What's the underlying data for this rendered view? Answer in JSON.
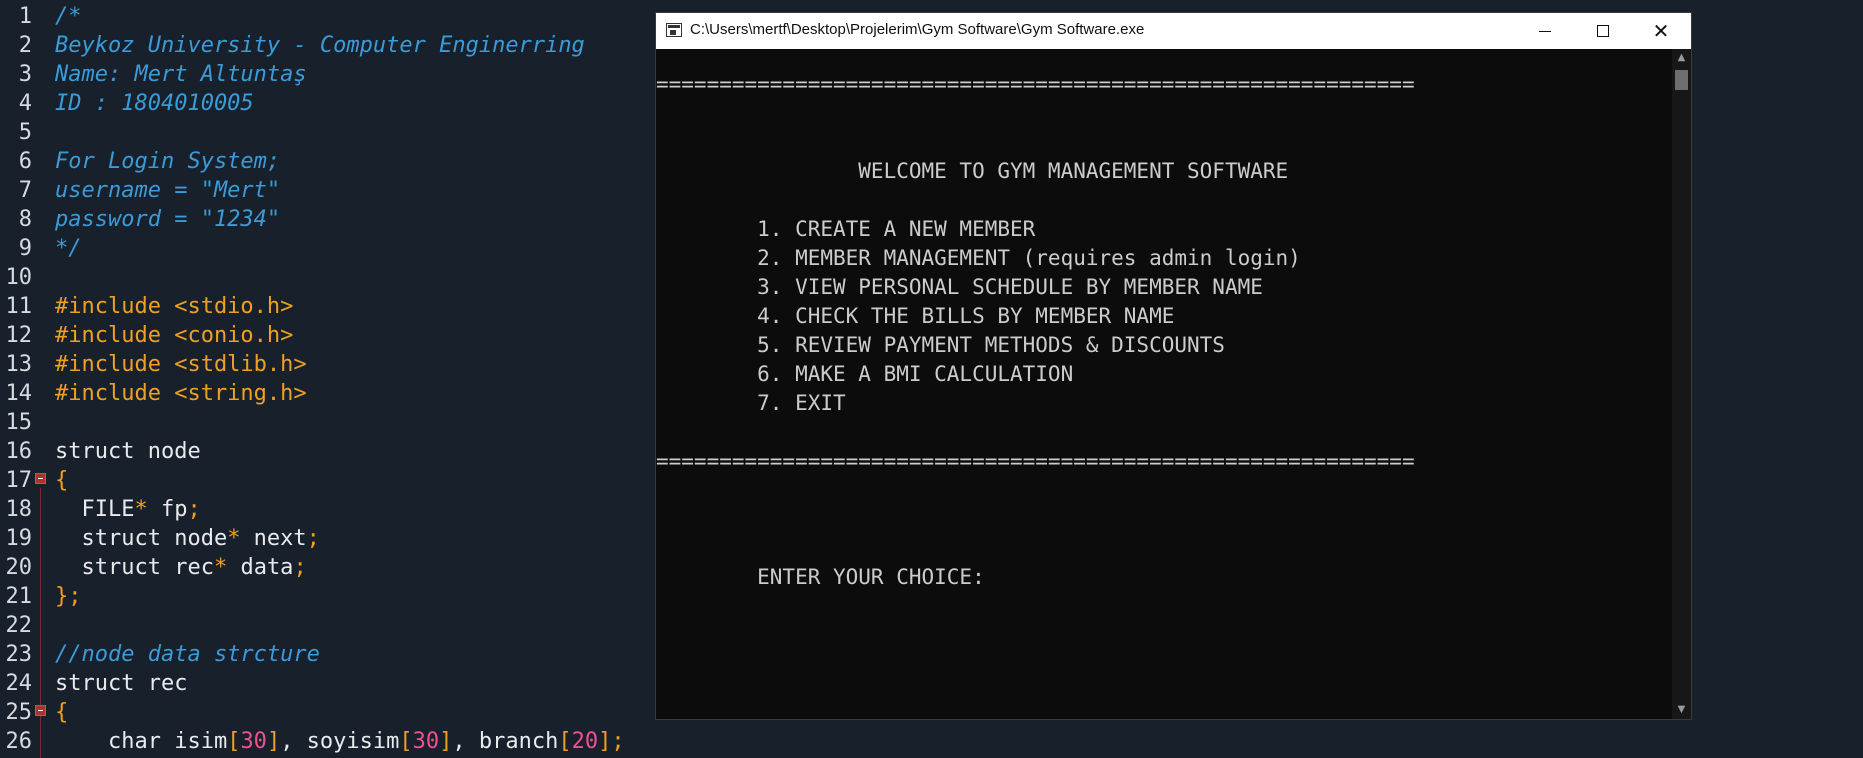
{
  "editor": {
    "line_numbers": [
      "1",
      "2",
      "3",
      "4",
      "5",
      "6",
      "7",
      "8",
      "9",
      "10",
      "11",
      "12",
      "13",
      "14",
      "15",
      "16",
      "17",
      "18",
      "19",
      "20",
      "21",
      "22",
      "23",
      "24",
      "25",
      "26"
    ],
    "lines": {
      "l1": "/*",
      "l2": "Beykoz University - Computer Enginerring",
      "l3": "Name: Mert Altuntaş",
      "l4": "ID : 1804010005",
      "l6": "For Login System;",
      "l7": "username = \"Mert\"",
      "l8": "password = \"1234\"",
      "l9": "*/",
      "l11": "#include <stdio.h>",
      "l12": "#include <conio.h>",
      "l13": "#include <stdlib.h>",
      "l14": "#include <string.h>",
      "l16_kw": "struct",
      "l16_rest": " node",
      "l17": "{",
      "l18_a": "  FILE",
      "l18_b": "*",
      "l18_c": " fp",
      "l18_d": ";",
      "l19_a": "  struct node",
      "l19_b": "*",
      "l19_c": " next",
      "l19_d": ";",
      "l20_a": "  struct rec",
      "l20_b": "*",
      "l20_c": " data",
      "l20_d": ";",
      "l21_a": "}",
      "l21_b": ";",
      "l23": "//node data strcture",
      "l24_kw": "struct",
      "l24_rest": " rec",
      "l25": "{",
      "l26_a": "    char isim",
      "l26_b": "[",
      "l26_c": "30",
      "l26_d": "]",
      "l26_e": ", soyisim",
      "l26_f": "[",
      "l26_g": "30",
      "l26_h": "]",
      "l26_i": ", branch",
      "l26_j": "[",
      "l26_k": "20",
      "l26_l": "]",
      "l26_m": ";"
    }
  },
  "console": {
    "title": "C:\\Users\\mertf\\Desktop\\Projelerim\\Gym Software\\Gym Software.exe",
    "separator": "============================================================",
    "welcome": "                WELCOME TO GYM MANAGEMENT SOFTWARE",
    "menu": [
      "        1. CREATE A NEW MEMBER",
      "        2. MEMBER MANAGEMENT (requires admin login)",
      "        3. VIEW PERSONAL SCHEDULE BY MEMBER NAME",
      "        4. CHECK THE BILLS BY MEMBER NAME",
      "        5. REVIEW PAYMENT METHODS & DISCOUNTS",
      "        6. MAKE A BMI CALCULATION",
      "        7. EXIT"
    ],
    "prompt": "        ENTER YOUR CHOICE:"
  }
}
